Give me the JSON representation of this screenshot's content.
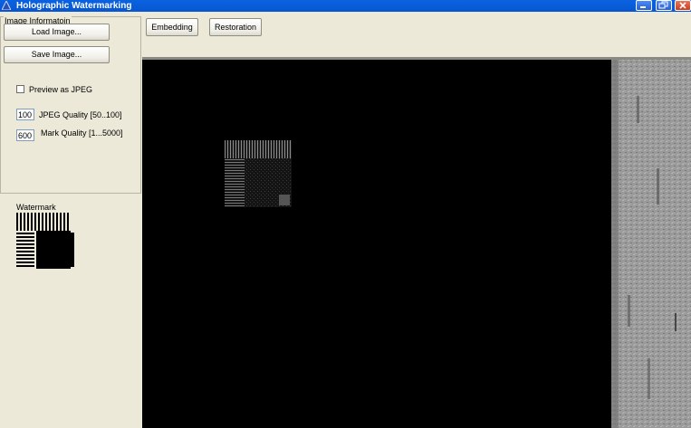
{
  "window": {
    "title": "Holographic Watermarking",
    "icons": [
      "app-icon",
      "minimize-icon",
      "maximize-icon",
      "close-icon"
    ]
  },
  "image_info": {
    "group_title": "Image Informatoin",
    "load_button": "Load Image...",
    "save_button": "Save Image...",
    "preview_checkbox": {
      "label": "Preview as JPEG",
      "checked": false
    },
    "jpeg_quality": {
      "value": "100",
      "label": "JPEG Quality [50..100]"
    },
    "mark_quality": {
      "value": "600",
      "label": "Mark Quality [1...5000]"
    }
  },
  "watermark": {
    "label": "Watermark"
  },
  "toolbar": {
    "embedding_button": "Embedding",
    "restoration_button": "Restoration"
  },
  "colors": {
    "titlebar": "#0856d0",
    "background": "#ece9d8",
    "canvas": "#000000"
  }
}
